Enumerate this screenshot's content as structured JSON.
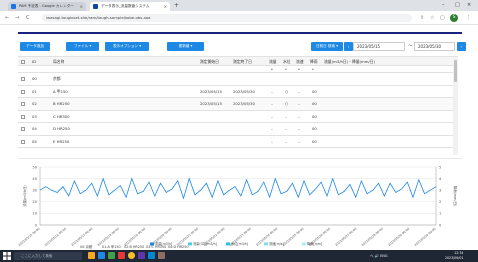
{
  "browser": {
    "tabs": [
      {
        "title": "PAM 予定表 - Google カレンダー",
        "close": "×"
      },
      {
        "title": "データ表示_流量数値システム",
        "close": "×"
      }
    ],
    "new_tab": "+",
    "window_controls": [
      "–",
      "□",
      "×"
    ],
    "nav": {
      "back": "←",
      "forward": "→",
      "reload": "C"
    },
    "url": "iwasagi.tougloset.site/ram/tough-sample/kobe-obs.aaa",
    "profile_initial": "S"
  },
  "toolbar": {
    "buttons": [
      "データ追加",
      "ファイル ▾",
      "表示オプション ▾",
      "更新値 ▾"
    ],
    "selector": "日前日 検索 ▾",
    "date_from": "2023/05/15",
    "date_sep": "〜",
    "date_to": "2023/05/30",
    "colors": {
      "button": "#1e88e5",
      "accent_line": "#1a237e"
    }
  },
  "table": {
    "columns": [
      "ID",
      "局名称",
      "測定開始日",
      "測定終了日",
      "流量",
      "水位",
      "流速",
      "降雨",
      "流量(m3/h日)・降量(mm/日)"
    ],
    "sub_row": [
      "",
      "",
      "",
      "",
      "*",
      "*",
      "*",
      "*",
      ""
    ],
    "rows": [
      {
        "id": "00",
        "name": "京都",
        "start": "",
        "end": "",
        "flow": "",
        "level": "",
        "speed": "",
        "rain": ""
      },
      {
        "id": "01",
        "name": "A 甲150",
        "start": "2023/05/15",
        "end": "2023/05/30",
        "flow": "–",
        "level": "○",
        "speed": "–",
        "rain": "00"
      },
      {
        "id": "02",
        "name": "B HR250",
        "start": "2023/05/15",
        "end": "2023/05/30",
        "flow": "–",
        "level": "○",
        "speed": "–",
        "rain": "00"
      },
      {
        "id": "03",
        "name": "C HR350",
        "start": "",
        "end": "",
        "flow": "–",
        "level": "–",
        "speed": "–",
        "rain": "00"
      },
      {
        "id": "04",
        "name": "D HR250",
        "start": "",
        "end": "",
        "flow": "–",
        "level": "–",
        "speed": "–",
        "rain": "00"
      },
      {
        "id": "05",
        "name": "E HR250",
        "start": "",
        "end": "",
        "flow": "–",
        "level": "–",
        "speed": "–",
        "rain": "00"
      }
    ]
  },
  "chart_data": {
    "type": "line",
    "ylabel": "流量(m3/h日)",
    "y2label": "降雨(mm/日)",
    "yticks": [
      "50",
      "40",
      "30",
      "20",
      "10",
      "0"
    ],
    "y2ticks": [
      "5",
      "4",
      "3",
      "2",
      "1",
      "0"
    ],
    "ylim": [
      0,
      50
    ],
    "xticks": [
      "2023/05/15 00:00",
      "2023/05/16 00:00",
      "2023/05/17 00:00",
      "2023/05/18 00:00",
      "2023/05/19 00:00",
      "2023/05/20 00:00",
      "2023/05/21 00:00",
      "2023/05/22 00:00",
      "2023/05/23 00:00",
      "2023/05/24 00:00",
      "2023/05/25 00:00",
      "2023/05/26 00:00",
      "2023/05/27 00:00",
      "2023/05/28 00:00",
      "2023/05/29 00:00",
      "2023/05/30 00:00"
    ],
    "series": [
      {
        "name": "流量[m3/h]",
        "color": "#1e88e5",
        "values": [
          30,
          33,
          30,
          28,
          33,
          25,
          38,
          27,
          30,
          36,
          25,
          40,
          26,
          30,
          34,
          24,
          40,
          27,
          29,
          37,
          25,
          36,
          28,
          31,
          38,
          23,
          40,
          26,
          30,
          36,
          24,
          38,
          26,
          30,
          33,
          25,
          39,
          26,
          29,
          37,
          24,
          40,
          27,
          29,
          36,
          24,
          38,
          26,
          31,
          37,
          25,
          40,
          26,
          29,
          35,
          24,
          38,
          27,
          30,
          36,
          25,
          36,
          28,
          31,
          37,
          24,
          39,
          27,
          30,
          33
        ]
      },
      {
        "name": "流量(GT)[m3/h]",
        "color": "#4dd0e1",
        "values": []
      },
      {
        "name": "水位[m]",
        "color": "#26c6da",
        "values": []
      },
      {
        "name": "流速[m/s]",
        "color": "#80deea",
        "values": []
      },
      {
        "name": "降雨[mm]",
        "color": "#b2ebf2",
        "values": []
      }
    ],
    "legend": [
      "流量[m3/h]",
      "流量(GT)[m3/h]",
      "水位[m3/h]",
      "流速[m/s]",
      "降雨[mm]"
    ],
    "legend_position": "bottom",
    "grid": true
  },
  "sheet_tabs": [
    "00:京都",
    "01:A 甲150",
    "02:B HR250",
    "03:C HR350",
    "04:D HR250"
  ],
  "taskbar": {
    "search_placeholder": "ここに入力して検索",
    "tray_text": "ヘ 🔊 ENG",
    "time": "12:34",
    "date": "2023/06/01"
  }
}
